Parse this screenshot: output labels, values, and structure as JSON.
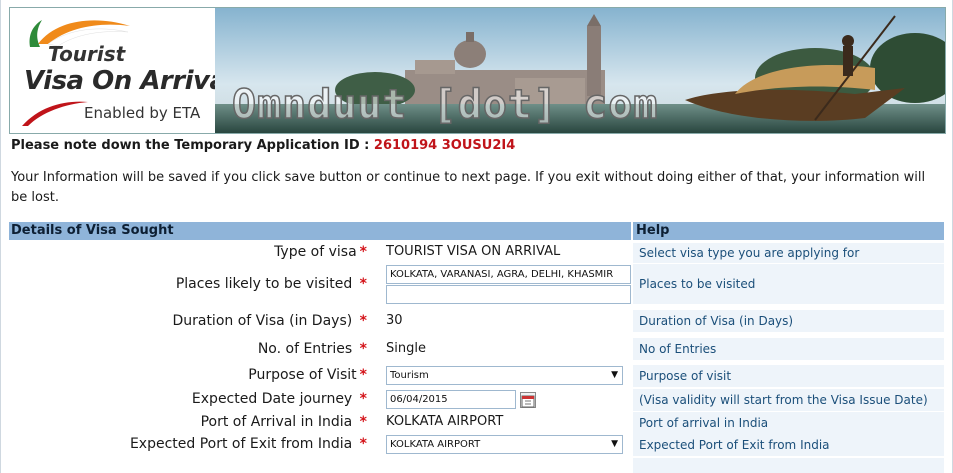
{
  "banner": {
    "logo_line1": "Tourist",
    "logo_line2": "Visa On Arrival",
    "logo_line3": "Enabled by ETA",
    "watermark": "Omnduut [dot] com"
  },
  "notice": {
    "app_id_label": "Please note down the Temporary Application ID : ",
    "app_id_value": "2610194 3OUSU2I4",
    "info": "Your Information will be saved if you click save button or continue to next page. If you exit without doing either of that, your information will be lost."
  },
  "form": {
    "section_title": "Details of Visa Sought",
    "help_title": "Help",
    "required_mark": "*",
    "rows": {
      "visa_type": {
        "label": "Type of visa",
        "value": "TOURIST VISA ON ARRIVAL",
        "help": "Select visa type you are applying for"
      },
      "places": {
        "label": "Places likely to be visited ",
        "value1": "KOLKATA, VARANASI, AGRA, DELHI, KHASMIR",
        "value2": "",
        "help": "Places to be visited"
      },
      "duration": {
        "label": "Duration of Visa (in Days) ",
        "value": "30",
        "help": "Duration of Visa (in Days)"
      },
      "entries": {
        "label": "No. of Entries ",
        "value": "Single",
        "help": "No of Entries"
      },
      "purpose": {
        "label": "Purpose of Visit",
        "value": "Tourism",
        "help": "Purpose of visit"
      },
      "date": {
        "label": "Expected Date journey ",
        "value": "06/04/2015",
        "help": "(Visa validity will start from the Visa Issue Date)"
      },
      "arrival": {
        "label": "Port of Arrival in India ",
        "value": "KOLKATA AIRPORT",
        "help": "Port of arrival in India"
      },
      "exit": {
        "label": "Expected Port of Exit from India ",
        "value": "KOLKATA AIRPORT",
        "help": "Expected Port of Exit from India"
      }
    }
  },
  "colors": {
    "header_bg": "#8fb4d9",
    "help_bg": "#eef4fa",
    "required": "#d4141a",
    "app_id": "#c0141a"
  }
}
